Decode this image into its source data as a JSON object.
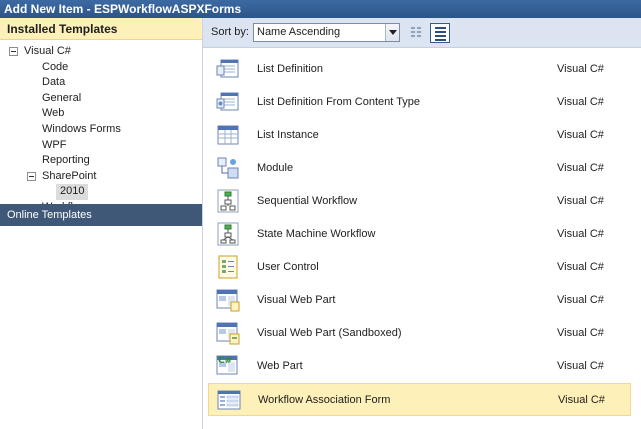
{
  "window": {
    "title": "Add New Item - ESPWorkflowASPXForms"
  },
  "left_panel": {
    "installed_header": "Installed Templates",
    "tree": [
      {
        "label": "Visual C#",
        "level": 0,
        "expanded": true
      },
      {
        "label": "Code",
        "level": 1
      },
      {
        "label": "Data",
        "level": 1
      },
      {
        "label": "General",
        "level": 1
      },
      {
        "label": "Web",
        "level": 1
      },
      {
        "label": "Windows Forms",
        "level": 1
      },
      {
        "label": "WPF",
        "level": 1
      },
      {
        "label": "Reporting",
        "level": 1
      },
      {
        "label": "SharePoint",
        "level": 1,
        "expanded": true
      },
      {
        "label": "2010",
        "level": 2,
        "selected": true
      },
      {
        "label": "Workflow",
        "level": 1
      }
    ],
    "online_templates": "Online Templates"
  },
  "toolbar": {
    "sort_label": "Sort by:",
    "sort_value": "Name Ascending"
  },
  "templates": [
    {
      "name": "List Definition",
      "language": "Visual C#",
      "icon": "list-definition-icon"
    },
    {
      "name": "List Definition From Content Type",
      "language": "Visual C#",
      "icon": "list-definition-content-type-icon"
    },
    {
      "name": "List Instance",
      "language": "Visual C#",
      "icon": "list-instance-icon"
    },
    {
      "name": "Module",
      "language": "Visual C#",
      "icon": "module-icon"
    },
    {
      "name": "Sequential Workflow",
      "language": "Visual C#",
      "icon": "sequential-workflow-icon"
    },
    {
      "name": "State Machine Workflow",
      "language": "Visual C#",
      "icon": "state-machine-workflow-icon"
    },
    {
      "name": "User Control",
      "language": "Visual C#",
      "icon": "user-control-icon"
    },
    {
      "name": "Visual Web Part",
      "language": "Visual C#",
      "icon": "visual-web-part-icon"
    },
    {
      "name": "Visual Web Part (Sandboxed)",
      "language": "Visual C#",
      "icon": "visual-web-part-sandboxed-icon"
    },
    {
      "name": "Web Part",
      "language": "Visual C#",
      "icon": "web-part-icon"
    },
    {
      "name": "Workflow Association Form",
      "language": "Visual C#",
      "icon": "workflow-association-form-icon",
      "selected": true
    }
  ],
  "colors": {
    "titlebar": "#2c5589",
    "header_highlight": "#fdf0b8",
    "online_bar": "#3f5878",
    "toolbar": "#dbe4f0"
  }
}
